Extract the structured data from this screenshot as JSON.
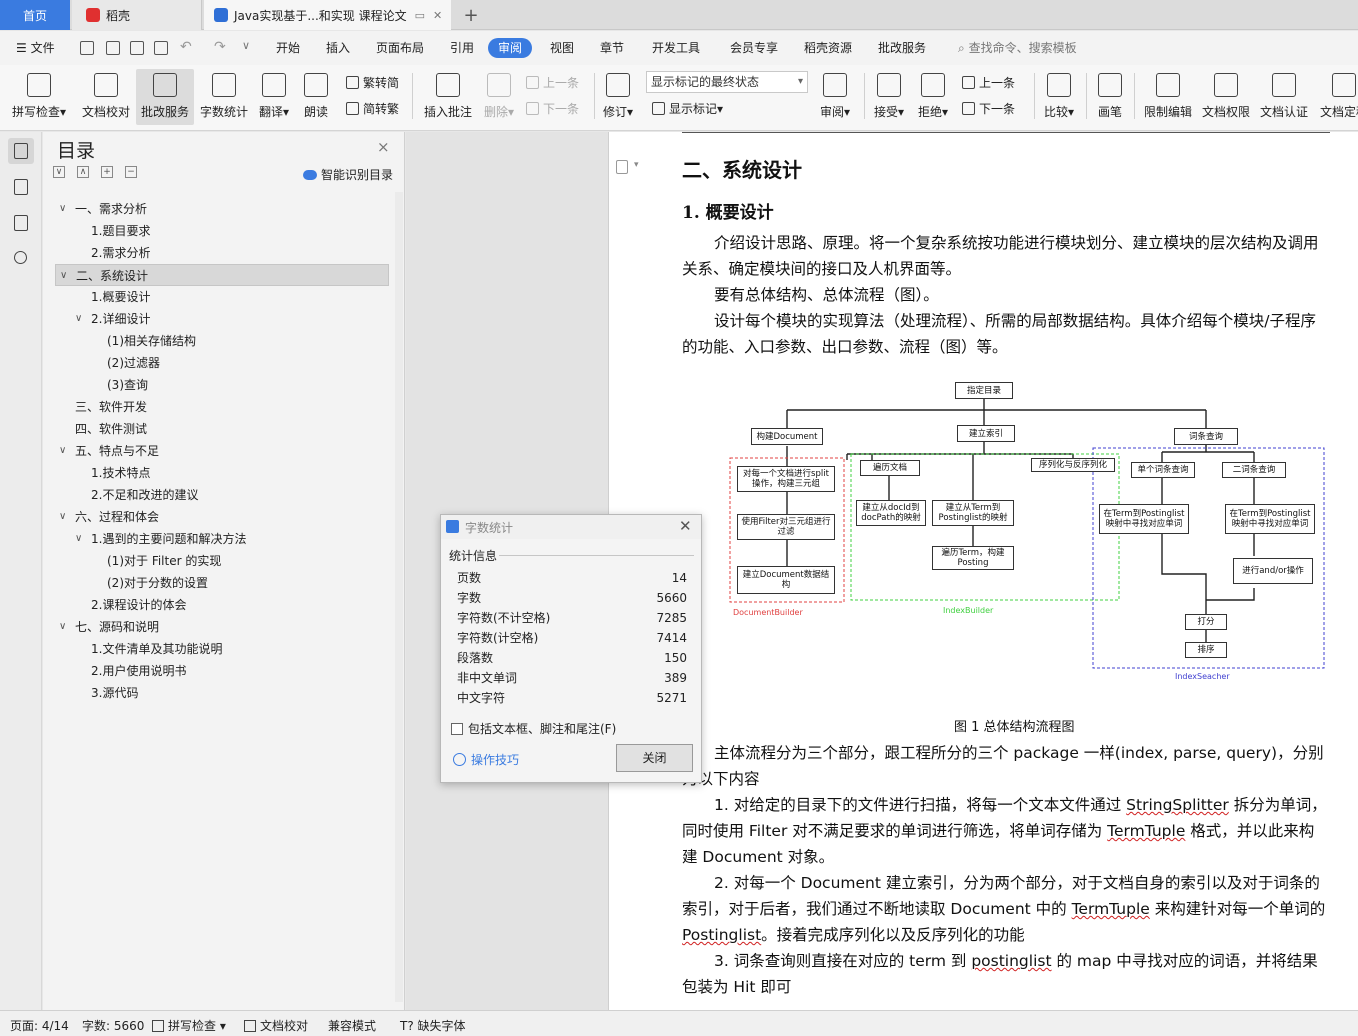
{
  "tabs": {
    "home": "首页",
    "wps": "稻壳",
    "doc": "Java实现基于...和实现 课程论文",
    "new": "+"
  },
  "menu": {
    "file": "文件",
    "items": [
      "开始",
      "插入",
      "页面布局",
      "引用",
      "审阅",
      "视图",
      "章节",
      "开发工具",
      "会员专享",
      "稻壳资源",
      "批改服务"
    ],
    "active": "审阅",
    "search": "查找命令、搜索模板"
  },
  "ribbon": {
    "spell": "拼写检查",
    "proof": "文档校对",
    "correct": "批改服务",
    "wordcount": "字数统计",
    "translate": "翻译",
    "read": "朗读",
    "to_trad": "繁转简",
    "to_simp": "简转繁",
    "insert_comment": "插入批注",
    "delete": "删除",
    "prev": "上一条",
    "next": "下一条",
    "revise": "修订",
    "markup_state": "显示标记的最终状态",
    "show_markup": "显示标记",
    "review": "审阅",
    "accept": "接受",
    "reject": "拒绝",
    "prev2": "上一条",
    "next2": "下一条",
    "compare": "比较",
    "pen": "画笔",
    "restrict": "限制编辑",
    "perm": "文档权限",
    "cert": "文档认证",
    "final": "文档定稿"
  },
  "toc": {
    "title": "目录",
    "smart": "智能识别目录",
    "close": "×",
    "items": [
      {
        "label": "一、需求分析",
        "level": 1,
        "arrow": "∨"
      },
      {
        "label": "1.题目要求",
        "level": 2,
        "arrow": ""
      },
      {
        "label": "2.需求分析",
        "level": 2,
        "arrow": ""
      },
      {
        "label": "二、系统设计",
        "level": 1,
        "arrow": "∨"
      },
      {
        "label": "1.概要设计",
        "level": 2,
        "arrow": ""
      },
      {
        "label": "2.详细设计",
        "level": 2,
        "arrow": "∨"
      },
      {
        "label": "(1)相关存储结构",
        "level": 3,
        "arrow": ""
      },
      {
        "label": "(2)过滤器",
        "level": 3,
        "arrow": ""
      },
      {
        "label": "(3)查询",
        "level": 3,
        "arrow": ""
      },
      {
        "label": "三、软件开发",
        "level": 1,
        "arrow": ""
      },
      {
        "label": "四、软件测试",
        "level": 1,
        "arrow": ""
      },
      {
        "label": "五、特点与不足",
        "level": 1,
        "arrow": "∨"
      },
      {
        "label": "1.技术特点",
        "level": 2,
        "arrow": ""
      },
      {
        "label": "2.不足和改进的建议",
        "level": 2,
        "arrow": ""
      },
      {
        "label": "六、过程和体会",
        "level": 1,
        "arrow": "∨"
      },
      {
        "label": "1.遇到的主要问题和解决方法",
        "level": 2,
        "arrow": "∨"
      },
      {
        "label": "(1)对于 Filter 的实现",
        "level": 3,
        "arrow": ""
      },
      {
        "label": "(2)对于分数的设置",
        "level": 3,
        "arrow": ""
      },
      {
        "label": "2.课程设计的体会",
        "level": 2,
        "arrow": ""
      },
      {
        "label": "七、源码和说明",
        "level": 1,
        "arrow": "∨"
      },
      {
        "label": "1.文件清单及其功能说明",
        "level": 2,
        "arrow": ""
      },
      {
        "label": "2.用户使用说明书",
        "level": 2,
        "arrow": ""
      },
      {
        "label": "3.源代码",
        "level": 2,
        "arrow": ""
      }
    ]
  },
  "doc": {
    "h2": "二、系统设计",
    "h3": "1. 概要设计",
    "p1": "介绍设计思路、原理。将一个复杂系统按功能进行模块划分、建立模块的层次结构及调用关系、确定模块间的接口及人机界面等。",
    "p2": "要有总体结构、总体流程（图）。",
    "p3": "设计每个模块的实现算法（处理流程）、所需的局部数据结构。具体介绍每个模块/子程序的功能、入口参数、出口参数、流程（图）等。",
    "caption": "图 1  总体结构流程图",
    "p4": "主体流程分为三个部分，跟工程所分的三个 package 一样(index, parse, query)，分别为以下内容",
    "p5a": "1. 对给定的目录下的文件进行扫描，将每一个文本文件通过 ",
    "p5b": "StringSplitter",
    "p5c": " 拆分为单词，同时使用 Filter 对不满足要求的单词进行筛选，将单词存储为 ",
    "p5d": "TermTuple",
    "p5e": " 格式，并以此来构建 Document 对象。",
    "p6a": "2. 对每一个 Document 建立索引，分为两个部分，对于文档自身的索引以及对于词条的索引，对于后者，我们通过不断地读取 Document 中的 ",
    "p6b": "TermTuple",
    "p6c": " 来构建针对每一个单词的 ",
    "p6d": "Postinglist",
    "p6e": "。接着完成序列化以及反序列化的功能",
    "p7a": "3. 词条查询则直接在对应的 term 到 ",
    "p7b": "postinglist",
    "p7c": " 的 map 中寻找对应的词语，并将结果包装为 Hit 即可"
  },
  "figure": {
    "root": "指定目录",
    "doc": "构建Document",
    "idx": "建立索引",
    "query": "词条查询",
    "d1": "对每一个文档进行split操作，构建三元组",
    "d2": "使用Filter对三元组进行过滤",
    "d3": "建立Document数据结构",
    "i1": "遍历文档",
    "i2": "序列化与反序列化",
    "i3": "建立从docId到docPath的映射",
    "i4": "建立从Term到Postinglist的映射",
    "i5": "遍历Term，构建Posting",
    "q1": "单个词条查询",
    "q2": "二词条查询",
    "q3": "在Term到Postinglist映射中寻找对应单词",
    "q4": "在Term到Postinglist映射中寻找对应单词",
    "q5": "进行and/or操作",
    "q6": "打分",
    "q7": "排序",
    "g1": "DocumentBuilder",
    "g2": "IndexBuilder",
    "g3": "IndexSeacher",
    "colors": {
      "g1": "#e04040",
      "g2": "#40d040",
      "g3": "#4040d0"
    }
  },
  "dialog": {
    "title": "字数统计",
    "section": "统计信息",
    "rows": [
      {
        "k": "页数",
        "v": "14"
      },
      {
        "k": "字数",
        "v": "5660"
      },
      {
        "k": "字符数(不计空格)",
        "v": "7285"
      },
      {
        "k": "字符数(计空格)",
        "v": "7414"
      },
      {
        "k": "段落数",
        "v": "150"
      },
      {
        "k": "非中文单词",
        "v": "389"
      },
      {
        "k": "中文字符",
        "v": "5271"
      }
    ],
    "checkbox": "包括文本框、脚注和尾注(F)",
    "tips": "操作技巧",
    "close": "关闭"
  },
  "status": {
    "page": "页面: 4/14",
    "words": "字数: 5660",
    "spell": "拼写检查",
    "proof": "文档校对",
    "compat": "兼容模式",
    "font": "缺失字体"
  },
  "accent": "#3a7be0"
}
